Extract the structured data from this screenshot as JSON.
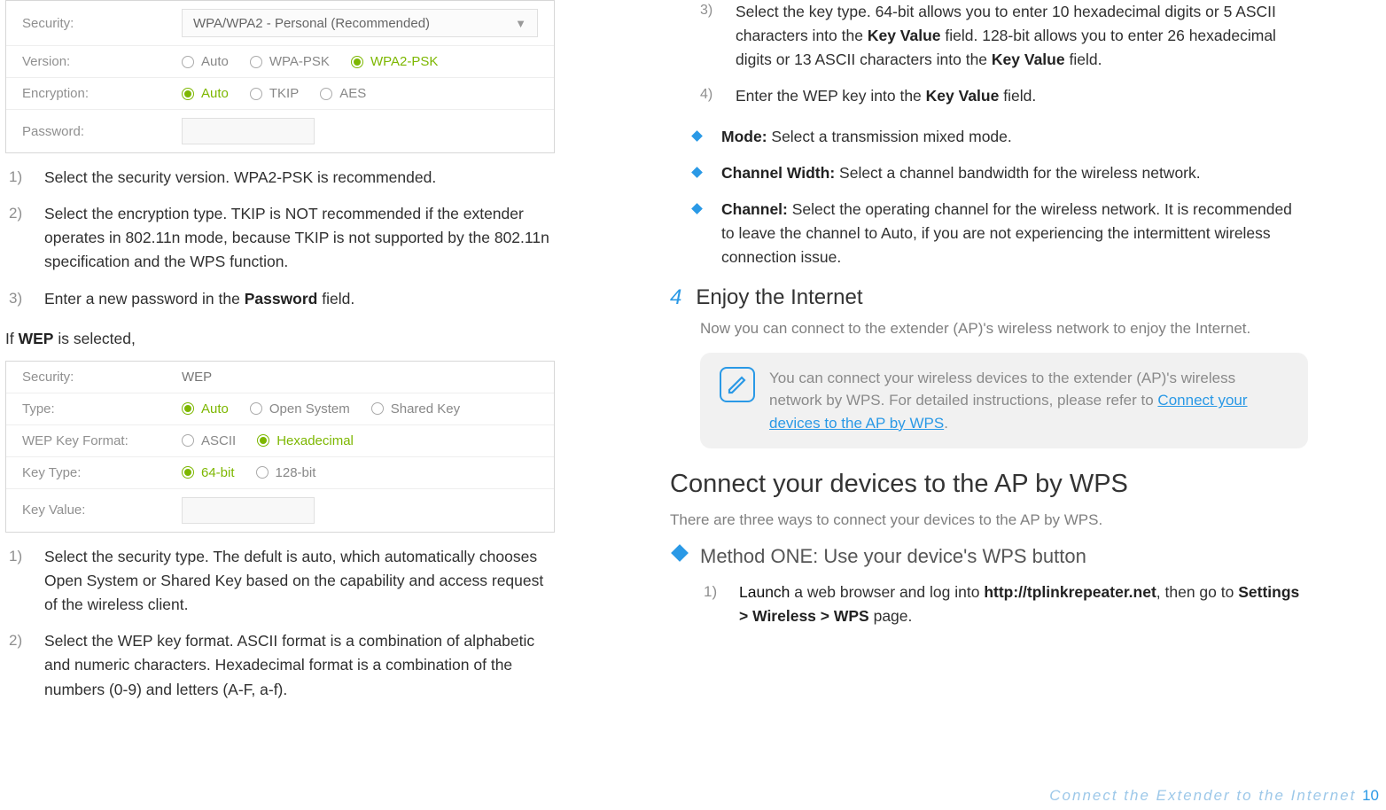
{
  "left": {
    "panel1": {
      "security_label": "Security:",
      "security_value": "WPA/WPA2 - Personal (Recommended)",
      "version_label": "Version:",
      "version_opts": [
        "Auto",
        "WPA-PSK",
        "WPA2-PSK"
      ],
      "encryption_label": "Encryption:",
      "encryption_opts": [
        "Auto",
        "TKIP",
        "AES"
      ],
      "password_label": "Password:"
    },
    "steps1": [
      "Select the security version. WPA2-PSK is recommended.",
      "Select the encryption type. TKIP is NOT recommended if the extender operates in 802.11n mode, because TKIP is not supported by the 802.11n specification and the WPS function.",
      "Enter a new password in the "
    ],
    "steps1_bold3": "Password",
    "steps1_tail3": " field.",
    "wep_heading_pre": "If ",
    "wep_heading_bold": "WEP",
    "wep_heading_post": " is selected,",
    "panel2": {
      "security_label": "Security:",
      "security_value": "WEP",
      "type_label": "Type:",
      "type_opts": [
        "Auto",
        "Open System",
        "Shared Key"
      ],
      "fmt_label": "WEP Key Format:",
      "fmt_opts": [
        "ASCII",
        "Hexadecimal"
      ],
      "ktype_label": "Key Type:",
      "ktype_opts": [
        "64-bit",
        "128-bit"
      ],
      "kval_label": "Key Value:"
    },
    "steps2": [
      "Select the security type. The defult is auto, which automatically chooses Open System or Shared Key based on the capability and access request of the wireless client.",
      "Select the WEP key format. ASCII format is a combination of alphabetic and numeric characters. Hexadecimal format is a combination of the numbers (0-9) and letters (A-F, a-f)."
    ]
  },
  "right": {
    "steps3_3_pre": "Select the key type. 64-bit allows you to enter 10 hexadecimal digits or 5 ASCII characters into the ",
    "steps3_3_b1": "Key Value",
    "steps3_3_mid": " field. 128-bit allows you to enter 26 hexadecimal digits or 13 ASCII characters into the ",
    "steps3_3_b2": "Key Value",
    "steps3_3_post": " field.",
    "steps3_4_pre": "Enter the WEP key into the ",
    "steps3_4_b": "Key Value",
    "steps3_4_post": " field.",
    "diamond": {
      "mode_label": "Mode:",
      "mode_text": " Select a transmission mixed mode.",
      "cw_label": "Channel Width:",
      "cw_text": " Select a channel bandwidth for the wireless network.",
      "ch_label": "Channel:",
      "ch_text": " Select the operating channel for the wireless network. It is recommended to leave the channel to Auto, if you are not experiencing the intermittent wireless connection issue."
    },
    "step4_num": "4",
    "step4_title": "Enjoy the Internet",
    "step4_sub": "Now you can connect to the extender (AP)'s wireless network to enjoy the Internet.",
    "note_text_pre": "You can connect your wireless devices to the extender (AP)'s wireless network by WPS. For detailed instructions, please refer to ",
    "note_link": "Connect your devices to the AP by WPS",
    "note_text_post": ".",
    "section2_title": "Connect your devices to the AP by WPS",
    "section2_intro": "There are three ways to connect your devices to the AP by WPS.",
    "method1_title": "Method ONE: Use your device's WPS button",
    "method1_s1_pre": "Launch",
    "method1_s1_mid": " a web browser and log into ",
    "method1_s1_b": "http://tplinkrepeater.net",
    "method1_s1_mid2": ", then go to ",
    "method1_s1_b2": "Settings > Wireless > WPS",
    "method1_s1_post": " page."
  },
  "footer_text": "Connect the Extender to the Internet",
  "page_num": "10"
}
